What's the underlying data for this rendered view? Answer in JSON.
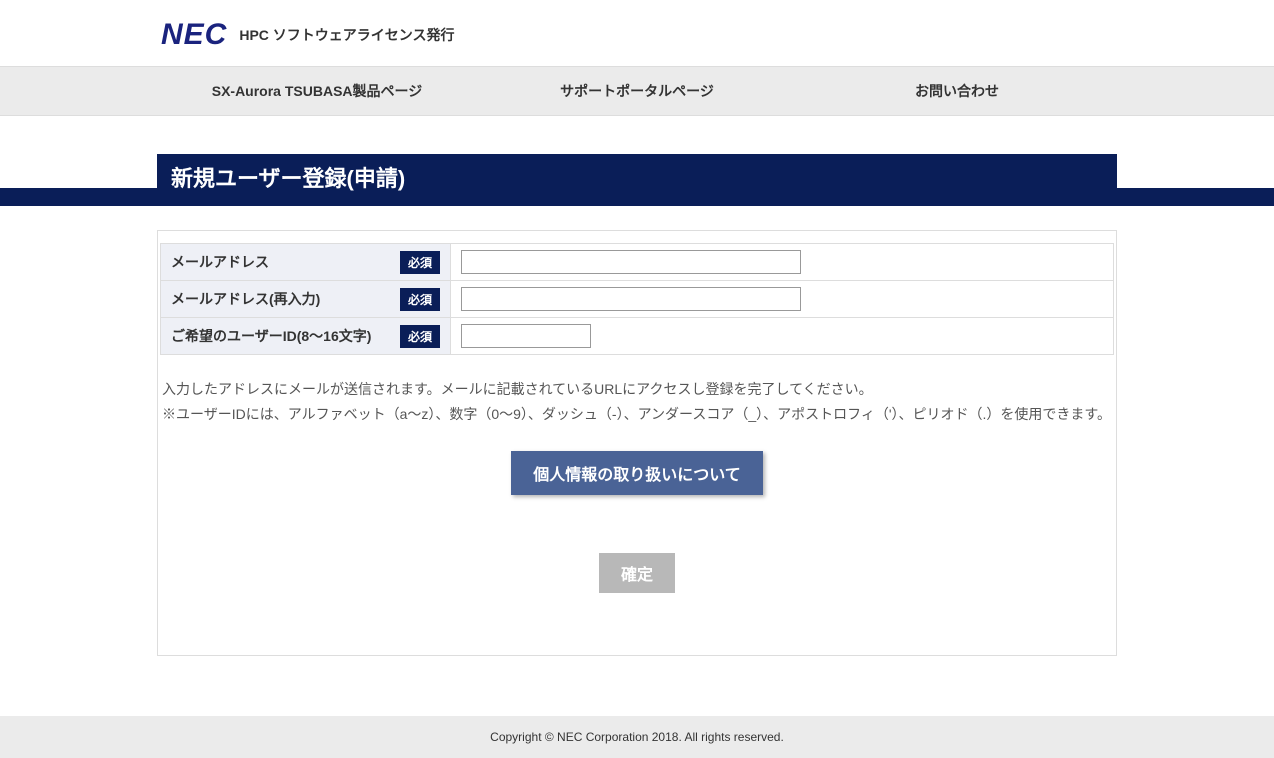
{
  "header": {
    "logo": "NEC",
    "subtitle": "HPC ソフトウェアライセンス発行"
  },
  "nav": {
    "items": [
      "SX-Aurora TSUBASA製品ページ",
      "サポートポータルページ",
      "お問い合わせ"
    ]
  },
  "title": "新規ユーザー登録(申請)",
  "form": {
    "required_label": "必須",
    "rows": [
      {
        "label": "メールアドレス",
        "value": "",
        "width": "wide"
      },
      {
        "label": "メールアドレス(再入力)",
        "value": "",
        "width": "wide"
      },
      {
        "label": "ご希望のユーザーID(8～16文字)",
        "value": "",
        "width": "short"
      }
    ]
  },
  "notes": {
    "line1": "入力したアドレスにメールが送信されます。メールに記載されているURLにアクセスし登録を完了してください。",
    "line2": "※ユーザーIDには、アルファベット（a～z）、数字（0～9）、ダッシュ（-）、アンダースコア（_）、アポストロフィ（'）、ピリオド（.）を使用できます。"
  },
  "buttons": {
    "privacy": "個人情報の取り扱いについて",
    "confirm": "確定"
  },
  "footer": "Copyright © NEC Corporation 2018. All rights reserved."
}
